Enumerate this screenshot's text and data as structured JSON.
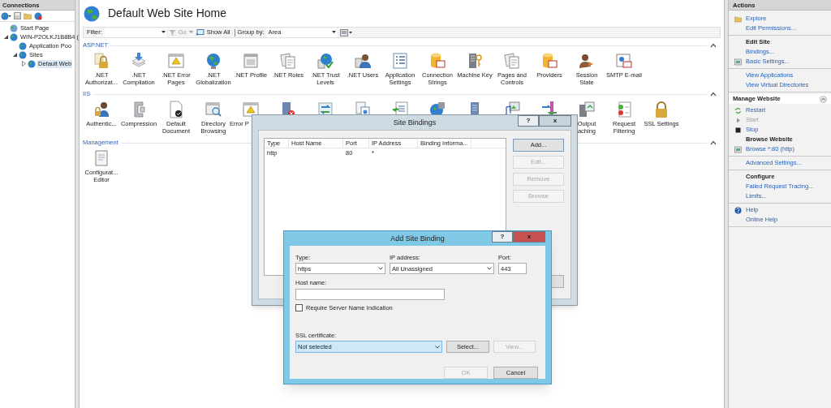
{
  "connections": {
    "title": "Connections",
    "tree": [
      {
        "label": "Start Page",
        "kind": "leaf",
        "selected": false
      },
      {
        "label": "WIN-P2OLKJ1B8B4 (",
        "kind": "node",
        "expanded": true,
        "selected": false,
        "children": [
          {
            "label": "Application Poo",
            "kind": "leaf",
            "selected": false
          },
          {
            "label": "Sites",
            "kind": "node",
            "expanded": true,
            "selected": false,
            "children": [
              {
                "label": "Default Web",
                "kind": "node",
                "expanded": false,
                "selected": true
              }
            ]
          }
        ]
      }
    ]
  },
  "main": {
    "title": "Default Web Site Home",
    "toolbar": {
      "filter_label": "Filter:",
      "go": "Go",
      "show_all": "Show All",
      "group_by_label": "Group by:",
      "group_by_value": "Area"
    },
    "sections": [
      {
        "title": "ASP.NET",
        "expanded": true,
        "features": [
          {
            "kind": "labeled",
            "label": ".NET Authorizat..."
          },
          {
            "kind": "labeled",
            "label": ".NET Compilation"
          },
          {
            "kind": "labeled",
            "label": ".NET Error Pages"
          },
          {
            "kind": "labeled",
            "label": ".NET Globalization"
          },
          {
            "kind": "labeled",
            "label": ".NET Profile"
          },
          {
            "kind": "labeled",
            "label": ".NET Roles"
          },
          {
            "kind": "labeled",
            "label": ".NET Trust Levels"
          },
          {
            "kind": "labeled",
            "label": ".NET Users"
          },
          {
            "kind": "labeled",
            "label": "Application Settings"
          },
          {
            "kind": "labeled",
            "label": "Connection Strings"
          },
          {
            "kind": "labeled",
            "label": "Machine Key"
          },
          {
            "kind": "labeled",
            "label": "Pages and Controls"
          },
          {
            "kind": "labeled",
            "label": "Providers"
          },
          {
            "kind": "labeled",
            "label": "Session State"
          },
          {
            "kind": "labeled",
            "label": "SMTP E-mail"
          }
        ]
      },
      {
        "title": "IIS",
        "expanded": true,
        "features": [
          {
            "kind": "labeled",
            "label": "Authentic..."
          },
          {
            "kind": "labeled",
            "label": "Compression"
          },
          {
            "kind": "labeled",
            "label": "Default Document"
          },
          {
            "kind": "labeled",
            "label": "Directory Browsing"
          },
          {
            "kind": "clipped",
            "label": "Error P"
          },
          {
            "kind": "icon-only"
          },
          {
            "kind": "icon-only"
          },
          {
            "kind": "icon-only"
          },
          {
            "kind": "icon-only"
          },
          {
            "kind": "icon-only"
          },
          {
            "kind": "icon-only"
          },
          {
            "kind": "icon-only"
          },
          {
            "kind": "icon-only"
          },
          {
            "kind": "labeled",
            "label": "Output aching"
          },
          {
            "kind": "labeled",
            "label": "Request Filtering"
          },
          {
            "kind": "labeled",
            "label": "SSL Settings"
          }
        ]
      },
      {
        "title": "Management",
        "expanded": true,
        "features": [
          {
            "kind": "labeled",
            "label": "Configurat... Editor"
          }
        ]
      }
    ]
  },
  "actions": {
    "title": "Actions",
    "groups": [
      {
        "items": [
          {
            "kind": "link",
            "label": "Explore",
            "disabled": false
          },
          {
            "kind": "link",
            "label": "Edit Permissions...",
            "disabled": false
          }
        ]
      },
      {
        "items": [
          {
            "kind": "heading",
            "label": "Edit Site"
          },
          {
            "kind": "link",
            "label": "Bindings...",
            "disabled": false
          },
          {
            "kind": "link",
            "label": "Basic Settings...",
            "disabled": false
          }
        ]
      },
      {
        "items": [
          {
            "kind": "link",
            "label": "View Applications",
            "disabled": false
          },
          {
            "kind": "link",
            "label": "View Virtual Directories",
            "disabled": false
          }
        ]
      }
    ],
    "sections": [
      {
        "title": "Manage Website",
        "expanded": true,
        "groups": [
          {
            "items": [
              {
                "kind": "link",
                "label": "Restart",
                "disabled": false
              },
              {
                "kind": "link",
                "label": "Start",
                "disabled": true
              },
              {
                "kind": "link",
                "label": "Stop",
                "disabled": false
              },
              {
                "kind": "heading",
                "label": "Browse Website"
              },
              {
                "kind": "link",
                "label": "Browse *:80 (http)",
                "disabled": false
              }
            ]
          },
          {
            "items": [
              {
                "kind": "link",
                "label": "Advanced Settings...",
                "disabled": false
              }
            ]
          },
          {
            "items": [
              {
                "kind": "heading",
                "label": "Configure"
              },
              {
                "kind": "link",
                "label": "Failed Request Tracing...",
                "disabled": false
              },
              {
                "kind": "link",
                "label": "Limits...",
                "disabled": false
              }
            ]
          },
          {
            "items": [
              {
                "kind": "link",
                "label": "Help",
                "disabled": false
              },
              {
                "kind": "link",
                "label": "Online Help",
                "disabled": false
              }
            ]
          }
        ]
      }
    ]
  },
  "site_bindings": {
    "title": "Site Bindings",
    "help_button": "?",
    "close_button": "x",
    "columns": [
      "Type",
      "Host Name",
      "Port",
      "IP Address",
      "Binding Informa..."
    ],
    "rows": [
      [
        "http",
        "",
        "80",
        "*",
        ""
      ]
    ],
    "buttons": [
      {
        "label": "Add...",
        "disabled": false
      },
      {
        "label": "Edit...",
        "disabled": true
      },
      {
        "label": "Remove",
        "disabled": true
      },
      {
        "label": "Browse",
        "disabled": true
      }
    ]
  },
  "add_binding": {
    "title": "Add Site Binding",
    "help_button": "?",
    "close_button": "x",
    "type": {
      "label": "Type:",
      "value": "https"
    },
    "ip_address": {
      "label": "IP address:",
      "value": "All Unassigned"
    },
    "port": {
      "label": "Port:",
      "value": "443"
    },
    "host_name": {
      "label": "Host name:"
    },
    "sni": {
      "label": "Require Server Name Indication",
      "checked": false
    },
    "ssl_certificate": {
      "label": "SSL certificate:",
      "value": "Not selected"
    },
    "select_button": {
      "label": "Select...",
      "disabled": false
    },
    "view_button": {
      "label": "View...",
      "disabled": true
    },
    "ok_button": {
      "label": "OK",
      "disabled": true
    },
    "cancel_button": {
      "label": "Cancel",
      "disabled": false
    }
  }
}
